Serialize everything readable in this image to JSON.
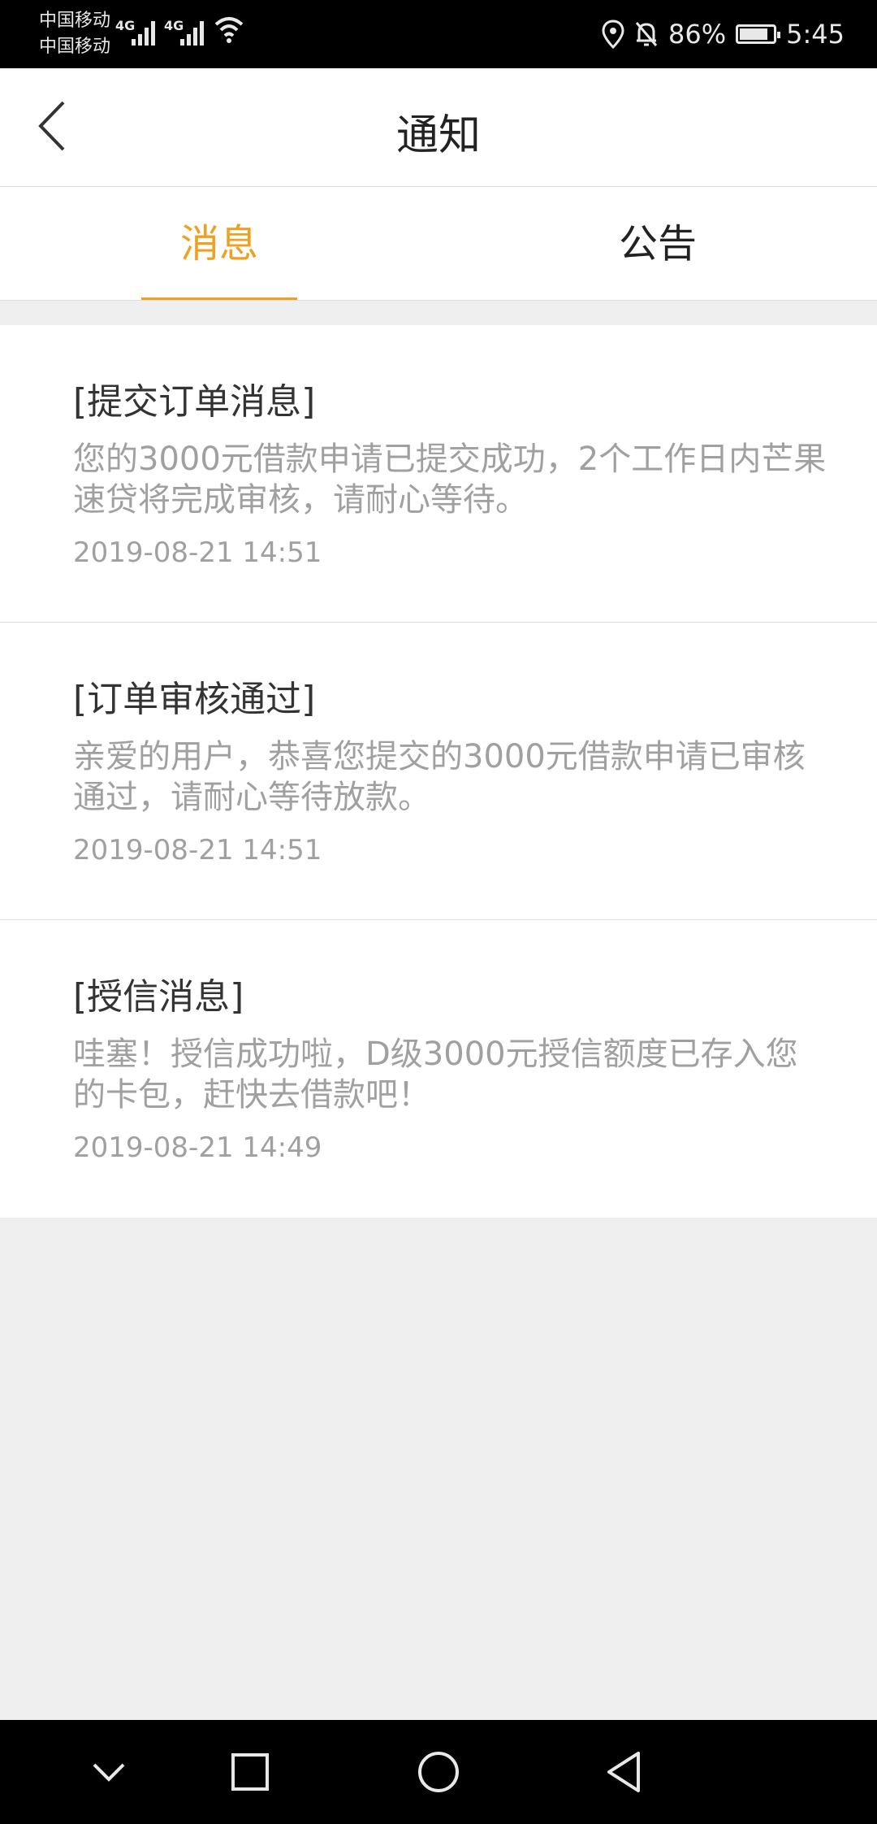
{
  "status_bar": {
    "carrier_1": "中国移动",
    "carrier_2": "中国移动",
    "network_1": "4G",
    "network_2": "4G",
    "battery_percent": "86%",
    "battery_level": 0.86,
    "time": "5:45",
    "icons": [
      "signal-icon",
      "wifi-icon",
      "location-icon",
      "bell-off-icon",
      "battery-icon"
    ]
  },
  "header": {
    "title": "通知",
    "back_icon": "chevron-left-icon"
  },
  "tabs": [
    {
      "label": "消息",
      "active": true
    },
    {
      "label": "公告",
      "active": false
    }
  ],
  "accent_color": "#f0a020",
  "messages": [
    {
      "title": "[提交订单消息]",
      "body": "您的3000元借款申请已提交成功，2个工作日内芒果速贷将完成审核，请耐心等待。",
      "time": "2019-08-21 14:51"
    },
    {
      "title": "[订单审核通过]",
      "body": "亲爱的用户，恭喜您提交的3000元借款申请已审核通过，请耐心等待放款。",
      "time": "2019-08-21 14:51"
    },
    {
      "title": "[授信消息]",
      "body": "哇塞！授信成功啦，D级3000元授信额度已存入您的卡包，赶快去借款吧！",
      "time": "2019-08-21 14:49"
    }
  ],
  "nav_bar": {
    "icons": [
      "chevron-down-icon",
      "square-icon",
      "circle-icon",
      "triangle-back-icon"
    ]
  }
}
